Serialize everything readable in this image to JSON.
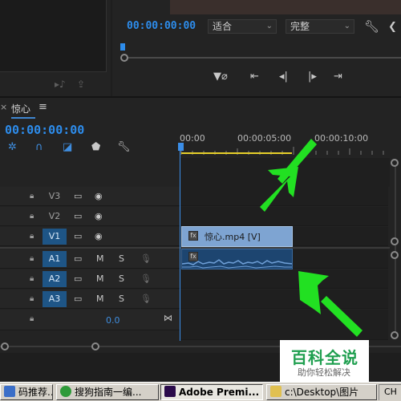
{
  "program": {
    "timecode": "00:00:00:00",
    "fit_label": "适合",
    "quality_label": "完整"
  },
  "timeline": {
    "tab_name": "惊心",
    "menu_icon": "≡",
    "close_icon": "×",
    "timecode": "00:00:00:00",
    "ruler": [
      "00:00",
      "00:00:05:00",
      "00:00:10:00"
    ],
    "tracks": [
      {
        "name": "V3",
        "type": "video",
        "active": false
      },
      {
        "name": "V2",
        "type": "video",
        "active": false
      },
      {
        "name": "V1",
        "type": "video",
        "active": true
      },
      {
        "name": "A1",
        "type": "audio",
        "active": true
      },
      {
        "name": "A2",
        "type": "audio",
        "active": true
      },
      {
        "name": "A3",
        "type": "audio",
        "active": true
      }
    ],
    "audio_letters": {
      "m": "M",
      "s": "S"
    },
    "master_value": "0.0",
    "clip_video_name": "惊心.mp4 [V]",
    "clip_fx": "fx"
  },
  "watermark": {
    "title": "百科全说",
    "subtitle": "助你轻松解决"
  },
  "taskbar": {
    "items": [
      {
        "label": "码推荐...",
        "pressed": false,
        "icon_color": "#3a6ec8"
      },
      {
        "label": "搜狗指南一编...",
        "pressed": false,
        "icon_color": "#2e9a3a"
      },
      {
        "label": "Adobe Premi...",
        "pressed": true,
        "icon_color": "#2a0a4a"
      },
      {
        "label": "c:\\Desktop\\图片",
        "pressed": false,
        "icon_color": "#e0c050"
      }
    ],
    "ime": "CH"
  },
  "colors": {
    "accent_blue": "#2d8ceb",
    "clip_video": "#7ea4d2",
    "clip_audio": "#1d4570",
    "arrow_green": "#22e022",
    "ruler_yellow": "#e6cf2a"
  }
}
